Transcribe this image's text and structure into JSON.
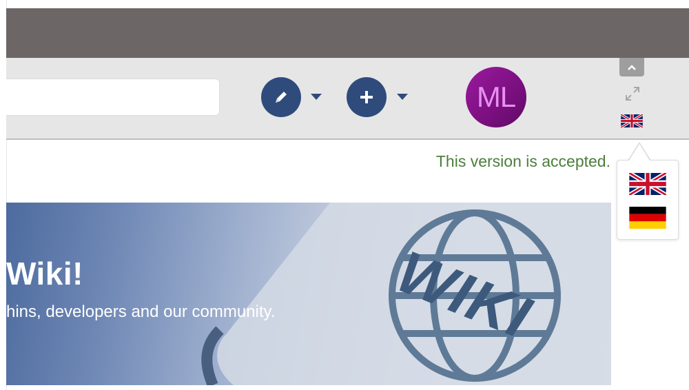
{
  "search": {
    "value": "",
    "placeholder": ""
  },
  "toolbar": {
    "edit_icon": "pencil-icon",
    "add_icon": "plus-icon",
    "avatar_initials": "ML",
    "accent_color": "#2f4b7c",
    "avatar_color": "#7a0f7f"
  },
  "status": {
    "text": "This version is accepted.",
    "color": "#4b7d3b"
  },
  "language": {
    "current": "English",
    "options": [
      "English",
      "German"
    ]
  },
  "banner": {
    "title": "Wiki!",
    "subtitle": "hins, developers and our community.",
    "image_label": "WIKI"
  }
}
